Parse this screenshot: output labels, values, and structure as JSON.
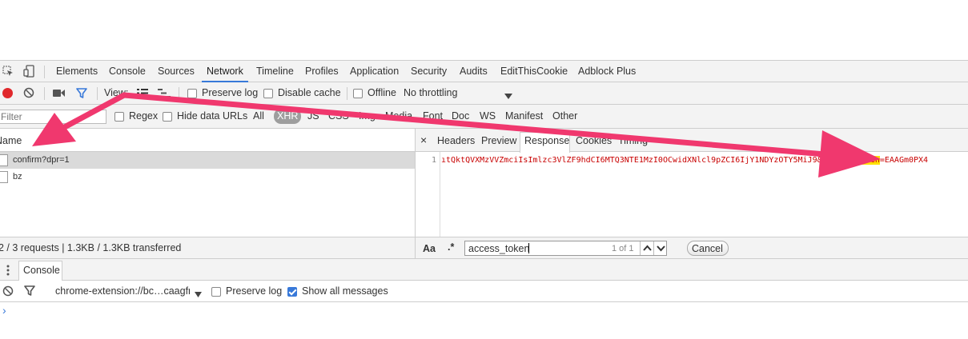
{
  "tabs": [
    "Elements",
    "Console",
    "Sources",
    "Network",
    "Timeline",
    "Profiles",
    "Application",
    "Security",
    "Audits",
    "EditThisCookie",
    "Adblock Plus"
  ],
  "active_tab": "Network",
  "toolbar": {
    "view_label": "View:",
    "preserve_log": "Preserve log",
    "disable_cache": "Disable cache",
    "offline": "Offline",
    "throttling": "No throttling"
  },
  "filter": {
    "placeholder": "Filter",
    "regex": "Regex",
    "hide_data_urls": "Hide data URLs",
    "types": [
      "All",
      "XHR",
      "JS",
      "CSS",
      "Img",
      "Media",
      "Font",
      "Doc",
      "WS",
      "Manifest",
      "Other"
    ]
  },
  "requests": {
    "header": "Name",
    "items": [
      "confirm?dpr=1",
      "bz"
    ],
    "summary": "2 / 3 requests | 1.3KB / 1.3KB transferred"
  },
  "detail": {
    "close": "×",
    "tabs": [
      "Headers",
      "Preview",
      "Response",
      "Cookies",
      "Timing"
    ],
    "active_tab": "Response",
    "line_number": "1",
    "response_prefix": "ıtQktQVXMzVVZmciIsImlzc3VlZF9hdCI6MTQ3NTE1MzI0OCwidXNlcl9pZCI6IjY1NDYzOTY5MiJ9&",
    "match": "access_token",
    "response_suffix": "=EAAGm0PX4"
  },
  "search": {
    "aa": "Aa",
    "regex": ".*",
    "query": "access_token",
    "count": "1 of 1",
    "cancel": "Cancel"
  },
  "console": {
    "tab": "Console",
    "context": "chrome-extension://bc…caagfr",
    "preserve_log": "Preserve log",
    "show_all": "Show all messages",
    "prompt": "›"
  },
  "colors": {
    "accent": "#3879d9",
    "record": "#e0282c",
    "annotation_arrow": "#f0386e",
    "highlight": "#ffe100",
    "response_text": "#c80000"
  }
}
